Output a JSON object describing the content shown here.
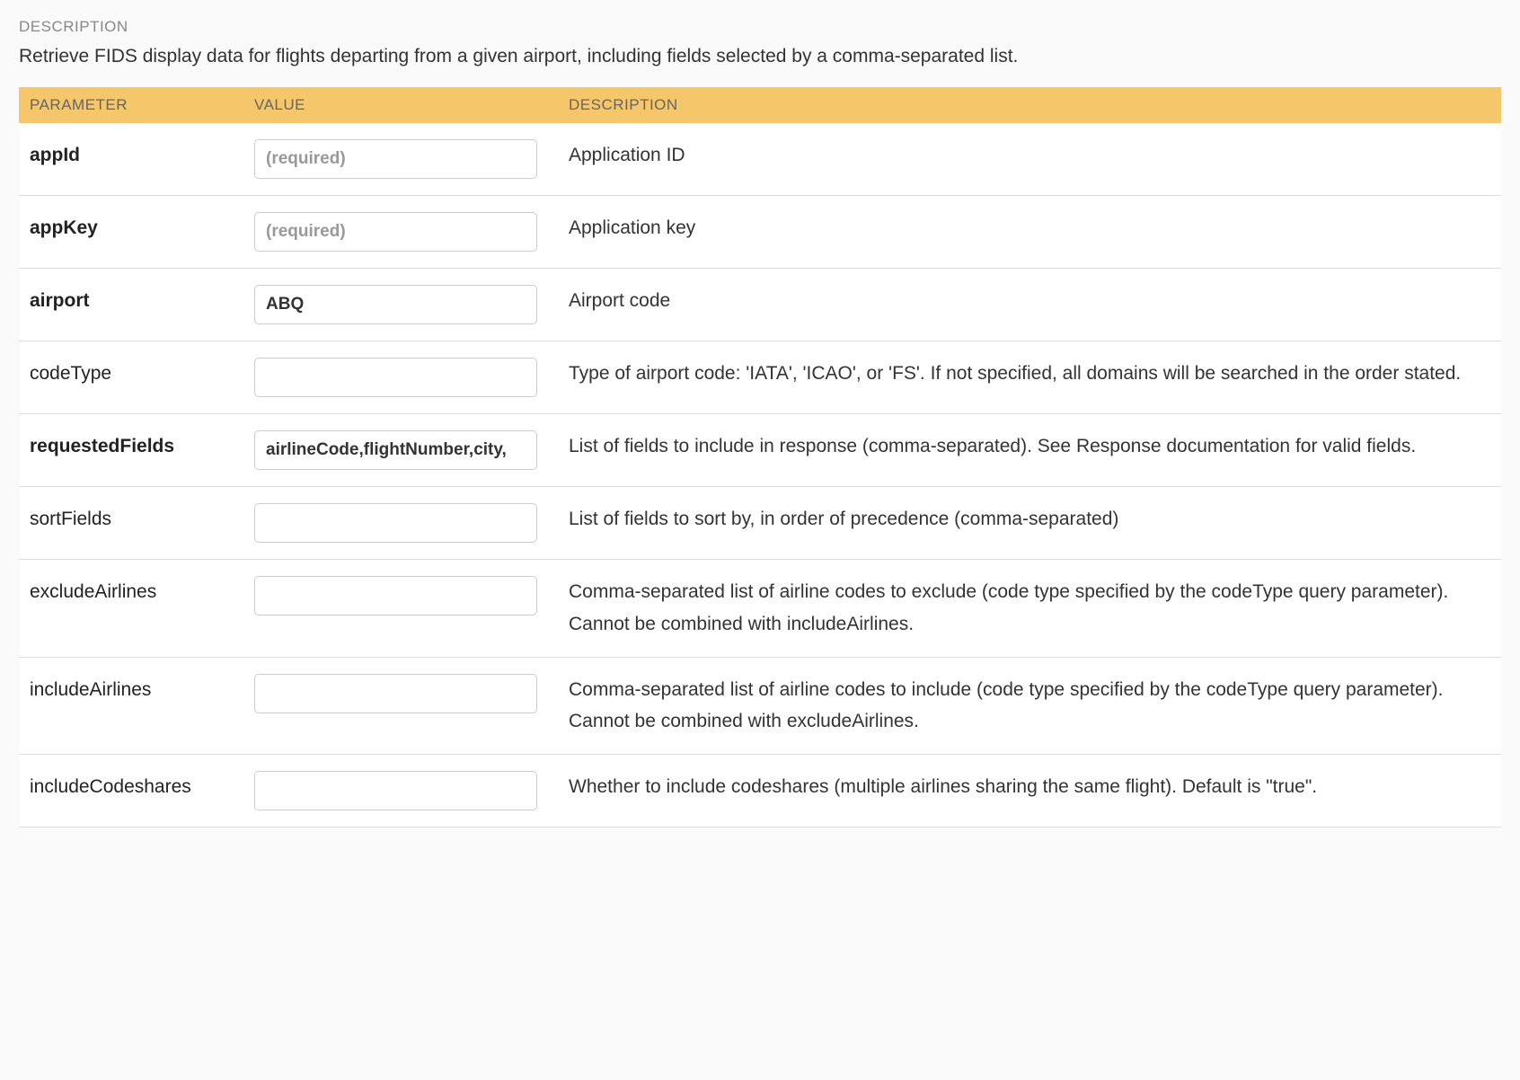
{
  "sectionLabel": "DESCRIPTION",
  "descriptionText": "Retrieve FIDS display data for flights departing from a given airport, including fields selected by a comma-separated list.",
  "headers": {
    "parameter": "PARAMETER",
    "value": "VALUE",
    "description": "DESCRIPTION"
  },
  "params": [
    {
      "name": "appId",
      "required": true,
      "placeholder": "(required)",
      "value": "",
      "desc": "Application ID"
    },
    {
      "name": "appKey",
      "required": true,
      "placeholder": "(required)",
      "value": "",
      "desc": "Application key"
    },
    {
      "name": "airport",
      "required": true,
      "placeholder": "",
      "value": "ABQ",
      "desc": "Airport code"
    },
    {
      "name": "codeType",
      "required": false,
      "placeholder": "",
      "value": "",
      "desc": "Type of airport code: 'IATA', 'ICAO', or 'FS'. If not specified, all domains will be searched in the order stated."
    },
    {
      "name": "requestedFields",
      "required": true,
      "placeholder": "",
      "value": "airlineCode,flightNumber,city,",
      "desc": "List of fields to include in response (comma-separated). See Response documentation for valid fields."
    },
    {
      "name": "sortFields",
      "required": false,
      "placeholder": "",
      "value": "",
      "desc": "List of fields to sort by, in order of precedence (comma-separated)"
    },
    {
      "name": "excludeAirlines",
      "required": false,
      "placeholder": "",
      "value": "",
      "desc": "Comma-separated list of airline codes to exclude (code type specified by the codeType query parameter). Cannot be combined with includeAirlines."
    },
    {
      "name": "includeAirlines",
      "required": false,
      "placeholder": "",
      "value": "",
      "desc": "Comma-separated list of airline codes to include (code type specified by the codeType query parameter). Cannot be combined with excludeAirlines."
    },
    {
      "name": "includeCodeshares",
      "required": false,
      "placeholder": "",
      "value": "",
      "desc": "Whether to include codeshares (multiple airlines sharing the same flight). Default is \"true\"."
    }
  ]
}
